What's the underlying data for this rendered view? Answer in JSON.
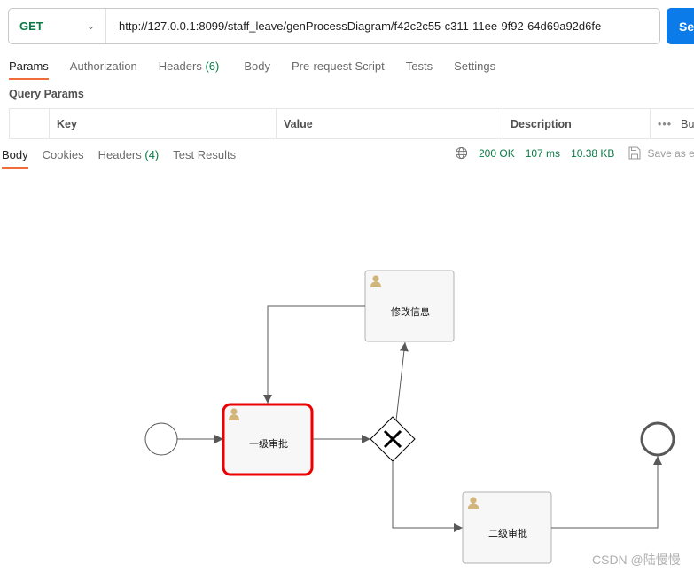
{
  "request": {
    "method": "GET",
    "url": "http://127.0.0.1:8099/staff_leave/genProcessDiagram/f42c2c55-c311-11ee-9f92-64d69a92d6fe",
    "send_label": "Se"
  },
  "request_tabs": [
    {
      "label": "Params",
      "active": true
    },
    {
      "label": "Authorization"
    },
    {
      "label": "Headers",
      "count": "(6)"
    },
    {
      "label": "Body"
    },
    {
      "label": "Pre-request Script"
    },
    {
      "label": "Tests"
    },
    {
      "label": "Settings"
    }
  ],
  "query_params": {
    "title": "Query Params",
    "columns": [
      "Key",
      "Value",
      "Description"
    ],
    "bulk_label": "Bu"
  },
  "response_tabs": [
    {
      "label": "Body",
      "active": true
    },
    {
      "label": "Cookies"
    },
    {
      "label": "Headers",
      "count": "(4)"
    },
    {
      "label": "Test Results"
    }
  ],
  "response_meta": {
    "status": "200 OK",
    "time": "107 ms",
    "size": "10.38 KB",
    "save_label": "Save as ex"
  },
  "diagram": {
    "nodes": {
      "task1": "一级审批",
      "task2": "修改信息",
      "task3": "二级审批"
    },
    "highlight_color": "#ee0000",
    "user_icon_color": "#d1b57a"
  },
  "watermark": "CSDN @陆慢慢"
}
